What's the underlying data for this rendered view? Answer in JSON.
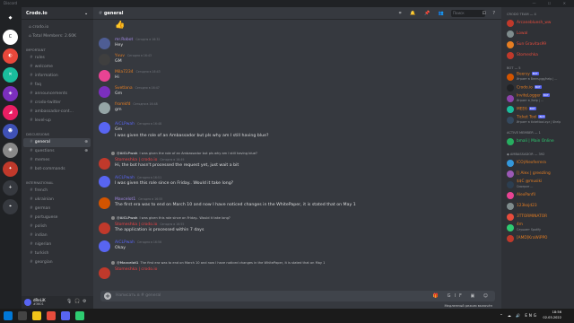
{
  "window": {
    "title": "Discord",
    "controls": "— ☐ ✕"
  },
  "servers": [
    {
      "label": "◆",
      "color": "#202225"
    },
    {
      "label": "C",
      "color": "#ffffff"
    },
    {
      "label": "◐",
      "color": "#e8483b",
      "badge": "16"
    },
    {
      "label": "✕",
      "color": "#1abc9c"
    },
    {
      "label": "◈",
      "color": "#7b2fbe",
      "badge": "1"
    },
    {
      "label": "◢",
      "color": "#e91e63",
      "badge": "2"
    },
    {
      "label": "☻",
      "color": "#3f51b5",
      "badge": "1"
    },
    {
      "label": "◉",
      "color": "#888888",
      "badge": "1"
    },
    {
      "label": "✦",
      "color": "#c0392b",
      "badge": "5"
    },
    {
      "label": "+",
      "color": "#36393f"
    },
    {
      "label": "⌖",
      "color": "#36393f"
    }
  ],
  "sidebar": {
    "server_name": "Crodo.io",
    "info": [
      "crodo.io",
      "Total Members: 2.60K"
    ],
    "categories": [
      {
        "name": "IMPORTANT",
        "channels": [
          "rules",
          "welcome",
          "information",
          "faq",
          "announcements",
          "crodo-twitter",
          "ambassador-cont...",
          "level-up"
        ]
      },
      {
        "name": "DISCUSSIONS",
        "channels": [
          "general",
          "questions",
          "memes",
          "bot-commands"
        ]
      },
      {
        "name": "INTERNATIONAL",
        "channels": [
          "french",
          "ukrainian",
          "german",
          "portuguese",
          "polish",
          "indian",
          "nigerian",
          "turkish",
          "georgian"
        ]
      }
    ],
    "user": {
      "name": "dReLiK",
      "tag": "#3601"
    }
  },
  "header": {
    "channel": "general",
    "search_placeholder": "Поиск",
    "tools": "⌗ 🔔 📌 👥",
    "inbox": "⊡ ?"
  },
  "messages": [
    {
      "name": "",
      "time": "",
      "text": "👍",
      "color": "#dcddde",
      "avatar": "#36393f"
    },
    {
      "name": "mr.Robot",
      "time": "Сегодня в 16:32",
      "text": "Hey",
      "color": "#a48be8",
      "avatar": "#4e5d94"
    },
    {
      "name": "Yvuv",
      "time": "Сегодня в 16:43",
      "text": "GM",
      "color": "#e67e22",
      "avatar": "#3f3f3f"
    },
    {
      "name": "Mila7234",
      "time": "Сегодня в 16:43",
      "text": "Hi",
      "color": "#e67e22",
      "avatar": "#e84393"
    },
    {
      "name": "Svetlana",
      "time": "Сегодня в 16:47",
      "text": "Gm",
      "color": "#e67e22",
      "avatar": "#7b2fbe"
    },
    {
      "name": "fromkfd",
      "time": "Сегодня в 16:48",
      "text": "gm",
      "color": "#e67e22",
      "avatar": "#95a5a6"
    },
    {
      "name": "AiCLPwah",
      "time": "Сегодня в 16:48",
      "text": "Gm",
      "color": "#5865f2",
      "avatar": "#5865f2"
    },
    {
      "name": "",
      "time": "",
      "text": "I was given the role of an Ambassador but pls why am I still having blue?",
      "color": "#dcddde",
      "avatar": ""
    },
    {
      "name": "Stomeshka | crodo.io",
      "time": "Сегодня в 16:49",
      "text": "Hi, the bot hasn't processed the request yet, just wait a bit",
      "color": "#ed4245",
      "avatar": "#c0392b",
      "reply": {
        "name": "@AiCLPwah",
        "text": "I was given the role of an Ambassador but pls why am I still having blue?"
      }
    },
    {
      "name": "AiCLPwah",
      "time": "Сегодня в 16:51",
      "text": "I was given this role since on Friday.. Would it take long?",
      "color": "#5865f2",
      "avatar": "#5865f2"
    },
    {
      "name": "Mavcelot1",
      "time": "Сегодня в 16:55",
      "text": "The first era was to end on March 10 and now I have noticed changes in the WhitePaper, it is stated that on May 1",
      "color": "#a48be8",
      "avatar": "#d35400"
    },
    {
      "name": "Stomeshka | crodo.io",
      "time": "Сегодня в 16:55",
      "text": "The application is processed within 7 days",
      "color": "#ed4245",
      "avatar": "#c0392b",
      "reply": {
        "name": "@AiCLPwah",
        "text": "I was given this role since on Friday.. Would it take long?"
      }
    },
    {
      "name": "AiCLPwah",
      "time": "Сегодня в 16:56",
      "text": "Okay",
      "color": "#5865f2",
      "avatar": "#5865f2"
    },
    {
      "name": "Stomeshka | crodo.io",
      "time": "",
      "text": "",
      "color": "#ed4245",
      "avatar": "#c0392b",
      "reply": {
        "name": "@Mavcelot1",
        "text": "The first era was to end on March 10 and now I have noticed changes in the WhitePaper, it is stated that on May 1"
      }
    }
  ],
  "composer": {
    "placeholder": "Написать в # general",
    "icons": "🎁 GIF ▣ ☺"
  },
  "status_line": "Медленный режим включён",
  "members": {
    "groups": [
      {
        "title": "CRODO TEAM — 4",
        "items": [
          {
            "name": "Arcanebluesh_ww",
            "status": "",
            "color": "#e74c3c",
            "avatar": "#c0392b"
          },
          {
            "name": "Lowal",
            "status": "",
            "color": "#e74c3c",
            "avatar": "#7f8c8d"
          },
          {
            "name": "Sun Gravitas99",
            "status": "",
            "color": "#e74c3c",
            "avatar": "#e67e22"
          },
          {
            "name": "Stomeshka",
            "status": "",
            "color": "#e74c3c",
            "avatar": "#c0392b"
          }
        ]
      },
      {
        "title": "BOT — 5",
        "items": [
          {
            "name": "Beersy",
            "status": "Играет в Beersy.gg/help | ...",
            "color": "#e67e22",
            "avatar": "#d35400",
            "bot": "BOT"
          },
          {
            "name": "Crodo.io",
            "status": "",
            "color": "#e67e22",
            "avatar": "#202225",
            "bot": "BOT"
          },
          {
            "name": "InviteLogger",
            "status": "Играет в /help | ...",
            "color": "#e67e22",
            "avatar": "#8e44ad",
            "bot": "BOT"
          },
          {
            "name": "MEE6",
            "status": "",
            "color": "#e67e22",
            "avatar": "#1abc9c",
            "bot": "BOT"
          },
          {
            "name": "Ticket Tool",
            "status": "Играет в tickettool.xyz | $help",
            "color": "#e67e22",
            "avatar": "#34495e",
            "bot": "BOT"
          }
        ]
      },
      {
        "title": "ACTIVE MEMBER — 1",
        "items": [
          {
            "name": "bmali | Main Online",
            "status": "",
            "color": "#2ecc71",
            "avatar": "#27ae60"
          }
        ]
      },
      {
        "title": "◆ AMBASSADOR — 392",
        "items": [
          {
            "name": "ICO|Alexferrera",
            "status": "",
            "color": "#e67e22",
            "avatar": "#3498db"
          },
          {
            "name": "[| Alex | greezling",
            "status": "",
            "color": "#e67e22",
            "avatar": "#9b59b6"
          },
          {
            "name": "$$C @musiki",
            "status": "Смотрит ...",
            "color": "#e67e22",
            "avatar": "#2c3e50"
          },
          {
            "name": "AlexPanfil",
            "status": "",
            "color": "#e67e22",
            "avatar": "#e84393"
          },
          {
            "name": "123kojd23",
            "status": "",
            "color": "#e67e22",
            "avatar": "#7f8c8d"
          },
          {
            "name": "3TTORMINATOR",
            "status": "",
            "color": "#e67e22",
            "avatar": "#e74c3c"
          },
          {
            "name": "4m",
            "status": "Слушает Spotify",
            "color": "#e67e22",
            "avatar": "#2ecc71"
          },
          {
            "name": "[AMD]KraWiPPO",
            "status": "",
            "color": "#e67e22",
            "avatar": "#c0392b"
          }
        ]
      }
    ]
  },
  "taskbar": {
    "time": "18:56",
    "date": "02.03.2022",
    "lang": "ENG",
    "tray": "⌃ ☁ 🔊"
  }
}
